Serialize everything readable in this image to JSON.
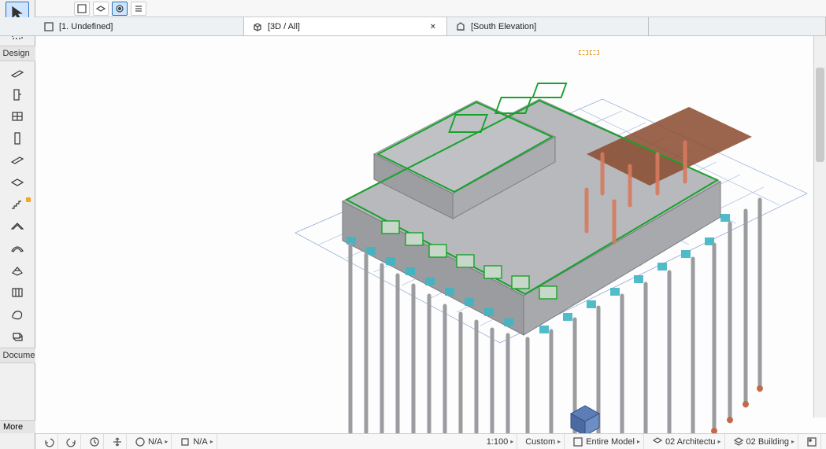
{
  "toolbox": {
    "section_design": "Design",
    "section_document": "Docume",
    "more_label": "More"
  },
  "tabs": [
    {
      "label": "[1. Undefined]",
      "active": false,
      "closable": false
    },
    {
      "label": "[3D / All]",
      "active": true,
      "closable": true
    },
    {
      "label": "[South Elevation]",
      "active": false,
      "closable": false
    }
  ],
  "statusbar": {
    "na1": "N/A",
    "na2": "N/A",
    "scale": "1:100",
    "zoom_mode": "Custom",
    "scope": "Entire Model",
    "layer_combo": "02 Architectu",
    "layer_combo2": "02 Building"
  }
}
